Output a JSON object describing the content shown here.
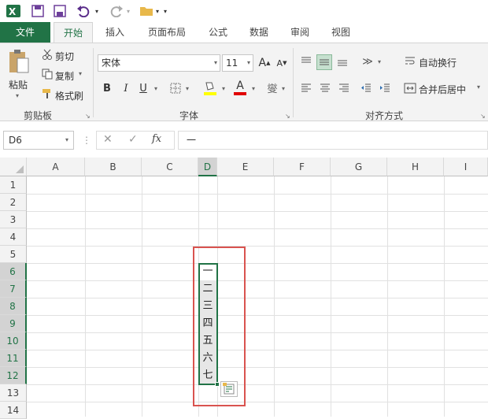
{
  "qat": {
    "app": "excel-icon",
    "save": "save-icon",
    "saveas": "save-as-icon",
    "undo": "undo-icon",
    "redo": "redo-icon",
    "open": "folder-icon"
  },
  "tabs": [
    "文件",
    "开始",
    "插入",
    "页面布局",
    "公式",
    "数据",
    "审阅",
    "视图"
  ],
  "clipboard": {
    "paste": "粘贴",
    "cut": "剪切",
    "copy": "复制",
    "painter": "格式刷",
    "group": "剪贴板"
  },
  "font": {
    "name": "宋体",
    "size": "11",
    "group": "字体",
    "bold": "B",
    "italic": "I",
    "underline": "U",
    "color_letter": "A",
    "grow": "A",
    "shrink": "A"
  },
  "alignment": {
    "wrap": "自动换行",
    "merge": "合并后居中",
    "group": "对齐方式"
  },
  "formula": {
    "cell_ref": "D6",
    "fx": "fx",
    "value": "一"
  },
  "columns": [
    "A",
    "B",
    "C",
    "D",
    "E",
    "F",
    "G",
    "H",
    "I"
  ],
  "rows": [
    "1",
    "2",
    "3",
    "4",
    "5",
    "6",
    "7",
    "8",
    "9",
    "10",
    "11",
    "12",
    "13",
    "14"
  ],
  "cells": {
    "D6": "一",
    "D7": "二",
    "D8": "三",
    "D9": "四",
    "D10": "五",
    "D11": "六",
    "D12": "七"
  },
  "colors": {
    "accent": "#217346",
    "highlight_box": "#d9534f",
    "selection": "#217346"
  }
}
